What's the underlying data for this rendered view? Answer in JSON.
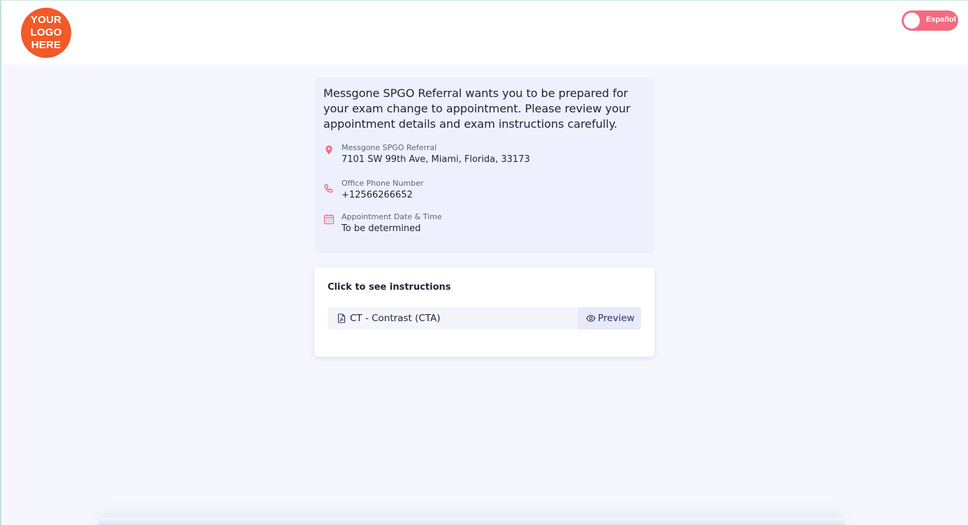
{
  "header": {
    "logo_text": "YOUR\nLOGO\nHERE",
    "language_toggle_label": "Español"
  },
  "info": {
    "intro": "Messgone SPGO Referral wants you to be prepared for your exam change to appointment. Please review your appointment details and exam instructions carefully.",
    "location": {
      "icon": "location-pin-icon",
      "caption": "Messgone SPGO Referral",
      "value": "7101 SW 99th Ave, Miami, Florida, 33173"
    },
    "phone": {
      "icon": "phone-icon",
      "caption": "Office Phone Number",
      "value": "+12566266652"
    },
    "appointment": {
      "icon": "calendar-icon",
      "caption": "Appointment Date & Time",
      "value": "To be determined"
    }
  },
  "instructions": {
    "title": "Click to see instructions",
    "document": {
      "icon": "pdf-file-icon",
      "name": "CT - Contrast (CTA)"
    },
    "preview_label": "Preview"
  },
  "colors": {
    "accent_pink": "#f26b80",
    "logo_orange": "#f15a29",
    "page_bg": "#f6f7fe",
    "info_card_bg": "#eef0fd"
  }
}
